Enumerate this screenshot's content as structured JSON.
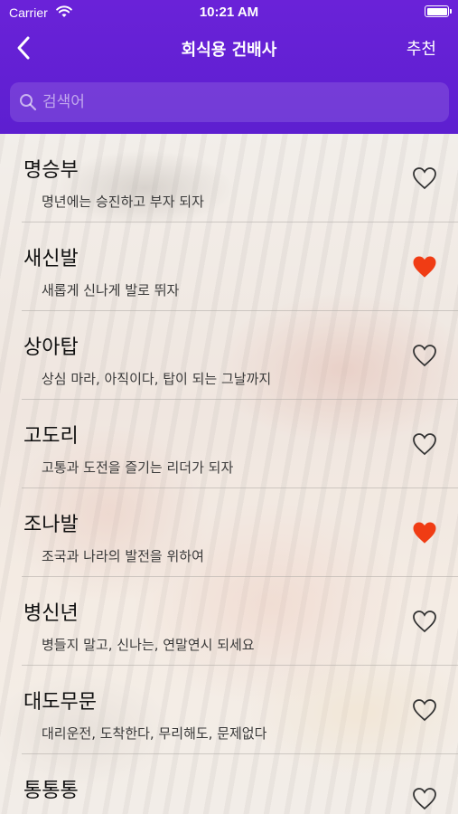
{
  "status_bar": {
    "carrier": "Carrier",
    "time": "10:21 AM"
  },
  "nav": {
    "title": "회식용 건배사",
    "right_button": "추천"
  },
  "search": {
    "placeholder": "검색어",
    "value": ""
  },
  "colors": {
    "accent": "#5e1fd1",
    "heart_filled": "#f03c14",
    "heart_outline": "#333333"
  },
  "items": [
    {
      "title": "명승부",
      "subtitle": "명년에는 승진하고 부자 되자",
      "favorite": false
    },
    {
      "title": "새신발",
      "subtitle": "새롭게 신나게 발로 뛰자",
      "favorite": true
    },
    {
      "title": "상아탑",
      "subtitle": "상심 마라, 아직이다, 탑이 되는 그날까지",
      "favorite": false
    },
    {
      "title": "고도리",
      "subtitle": "고통과 도전을 즐기는 리더가 되자",
      "favorite": false
    },
    {
      "title": "조나발",
      "subtitle": "조국과 나라의 발전을 위하여",
      "favorite": true
    },
    {
      "title": "병신년",
      "subtitle": "병들지 말고, 신나는, 연말연시 되세요",
      "favorite": false
    },
    {
      "title": "대도무문",
      "subtitle": "대리운전, 도착한다, 무리해도, 문제없다",
      "favorite": false
    },
    {
      "title": "통통통",
      "subtitle": "",
      "favorite": false
    }
  ]
}
